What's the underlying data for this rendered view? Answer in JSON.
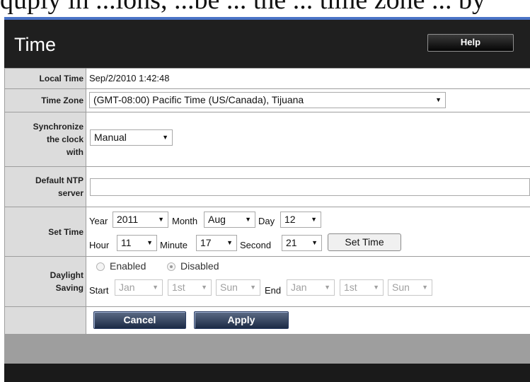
{
  "top_text": "quply in ...ions, ...be ... the ... time zone ... by",
  "page": {
    "title": "Time",
    "help_label": "Help"
  },
  "local_time": {
    "label": "Local Time",
    "value": "Sep/2/2010 1:42:48"
  },
  "time_zone": {
    "label": "Time Zone",
    "selected": "(GMT-08:00) Pacific Time (US/Canada), Tijuana"
  },
  "sync": {
    "label_lines": [
      "Synchronize",
      "the clock",
      "with"
    ],
    "selected": "Manual"
  },
  "ntp": {
    "label_lines": [
      "Default NTP",
      "server"
    ],
    "value": ""
  },
  "set_time": {
    "label": "Set Time",
    "year_label": "Year",
    "year": "2011",
    "month_label": "Month",
    "month": "Aug",
    "day_label": "Day",
    "day": "12",
    "hour_label": "Hour",
    "hour": "11",
    "minute_label": "Minute",
    "minute": "17",
    "second_label": "Second",
    "second": "21",
    "button": "Set Time"
  },
  "daylight": {
    "label_lines": [
      "Daylight",
      "Saving"
    ],
    "enabled_label": "Enabled",
    "disabled_label": "Disabled",
    "selected": "Disabled",
    "start_label": "Start",
    "start_month": "Jan",
    "start_week": "1st",
    "start_day": "Sun",
    "end_label": "End",
    "end_month": "Jan",
    "end_week": "1st",
    "end_day": "Sun"
  },
  "actions": {
    "cancel": "Cancel",
    "apply": "Apply"
  },
  "colors": {
    "accent_top": "#4a73c6",
    "header_bg": "#1f1f1f",
    "label_bg": "#dcdcdc",
    "action_button": "#1b2a45"
  },
  "icons": {
    "dropdown": "caret-down-icon"
  }
}
